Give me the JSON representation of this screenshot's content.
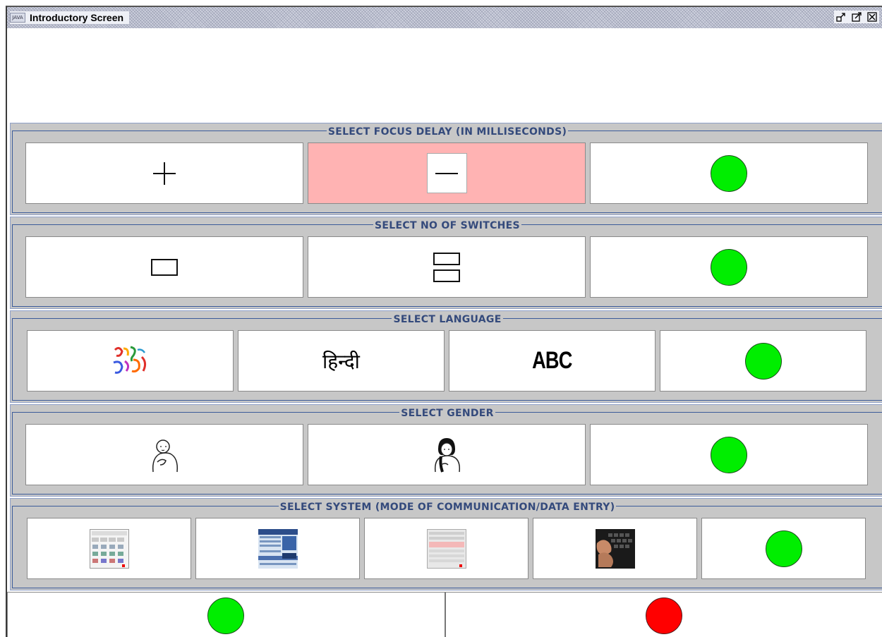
{
  "window": {
    "title": "Introductory Screen",
    "icon_label": "JAVA",
    "controls": [
      "minimize-icon",
      "maximize-icon",
      "close-icon"
    ]
  },
  "panels": [
    {
      "legend": "SELECT FOCUS DELAY (IN MILLISECONDS)",
      "options": [
        "plus-icon",
        "minus-icon",
        "confirm-green-circle"
      ],
      "highlighted_option": "minus-icon",
      "highlight_color": "#ffb3b3"
    },
    {
      "legend": "SELECT NO OF SWITCHES",
      "options": [
        "single-switch-icon",
        "double-switch-icon",
        "confirm-green-circle"
      ]
    },
    {
      "legend": "SELECT LANGUAGE",
      "options": [
        {
          "name": "regional-script-icon",
          "text": ""
        },
        {
          "name": "hindi-label",
          "text": "हिन्दी"
        },
        {
          "name": "english-label",
          "text": "ABC"
        },
        {
          "name": "confirm-green-circle",
          "text": ""
        }
      ]
    },
    {
      "legend": "SELECT GENDER",
      "options": [
        "male-person-icon",
        "female-person-icon",
        "confirm-green-circle"
      ]
    },
    {
      "legend": "SELECT SYSTEM (MODE OF COMMUNICATION/DATA ENTRY)",
      "options": [
        "symbol-grid-system-icon",
        "text-panel-system-icon",
        "table-list-system-icon",
        "keyboard-typing-icon",
        "confirm-green-circle"
      ]
    }
  ],
  "bottom": {
    "ok": "ok-green-circle",
    "cancel": "cancel-red-circle"
  },
  "colors": {
    "panel_bg": "#c7c7c7",
    "legend_text": "#344a7c",
    "confirm": "#00ee00",
    "cancel": "#ff0000",
    "highlight": "#ffb3b3"
  }
}
